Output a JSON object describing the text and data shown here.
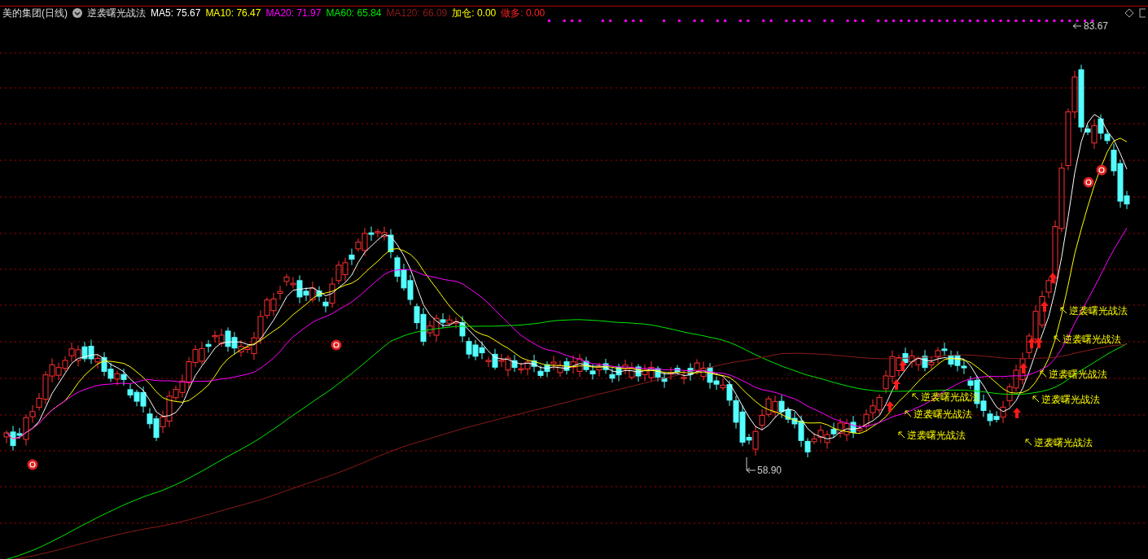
{
  "header": {
    "title": "美的集团(日线)",
    "indicator": "逆袭曙光战法",
    "values": [
      {
        "label": "MA5: 75.67",
        "color": "#ffffff"
      },
      {
        "label": "MA10: 76.47",
        "color": "#ffff00"
      },
      {
        "label": "MA20: 71.97",
        "color": "#ff00ff"
      },
      {
        "label": "MA60: 65.84",
        "color": "#00e600"
      },
      {
        "label": "MA120: 66.09",
        "color": "#8b1a1a"
      },
      {
        "label": "加仓: 0.00",
        "color": "#ffff00"
      },
      {
        "label": "做多: 0.00",
        "color": "#ff2020"
      }
    ]
  },
  "chart": {
    "high_label": "83.67",
    "low_label": "58.90",
    "signals": [
      {
        "label": "逆袭曙光战法"
      },
      {
        "label": "逆袭曙光战法"
      },
      {
        "label": "逆袭曙光战法"
      },
      {
        "label": "逆袭曙光战法"
      },
      {
        "label": "逆袭曙光战法"
      },
      {
        "label": "逆袭曙光战法"
      },
      {
        "label": "逆袭曙光战法"
      },
      {
        "label": "逆袭曙光战法"
      }
    ]
  }
}
